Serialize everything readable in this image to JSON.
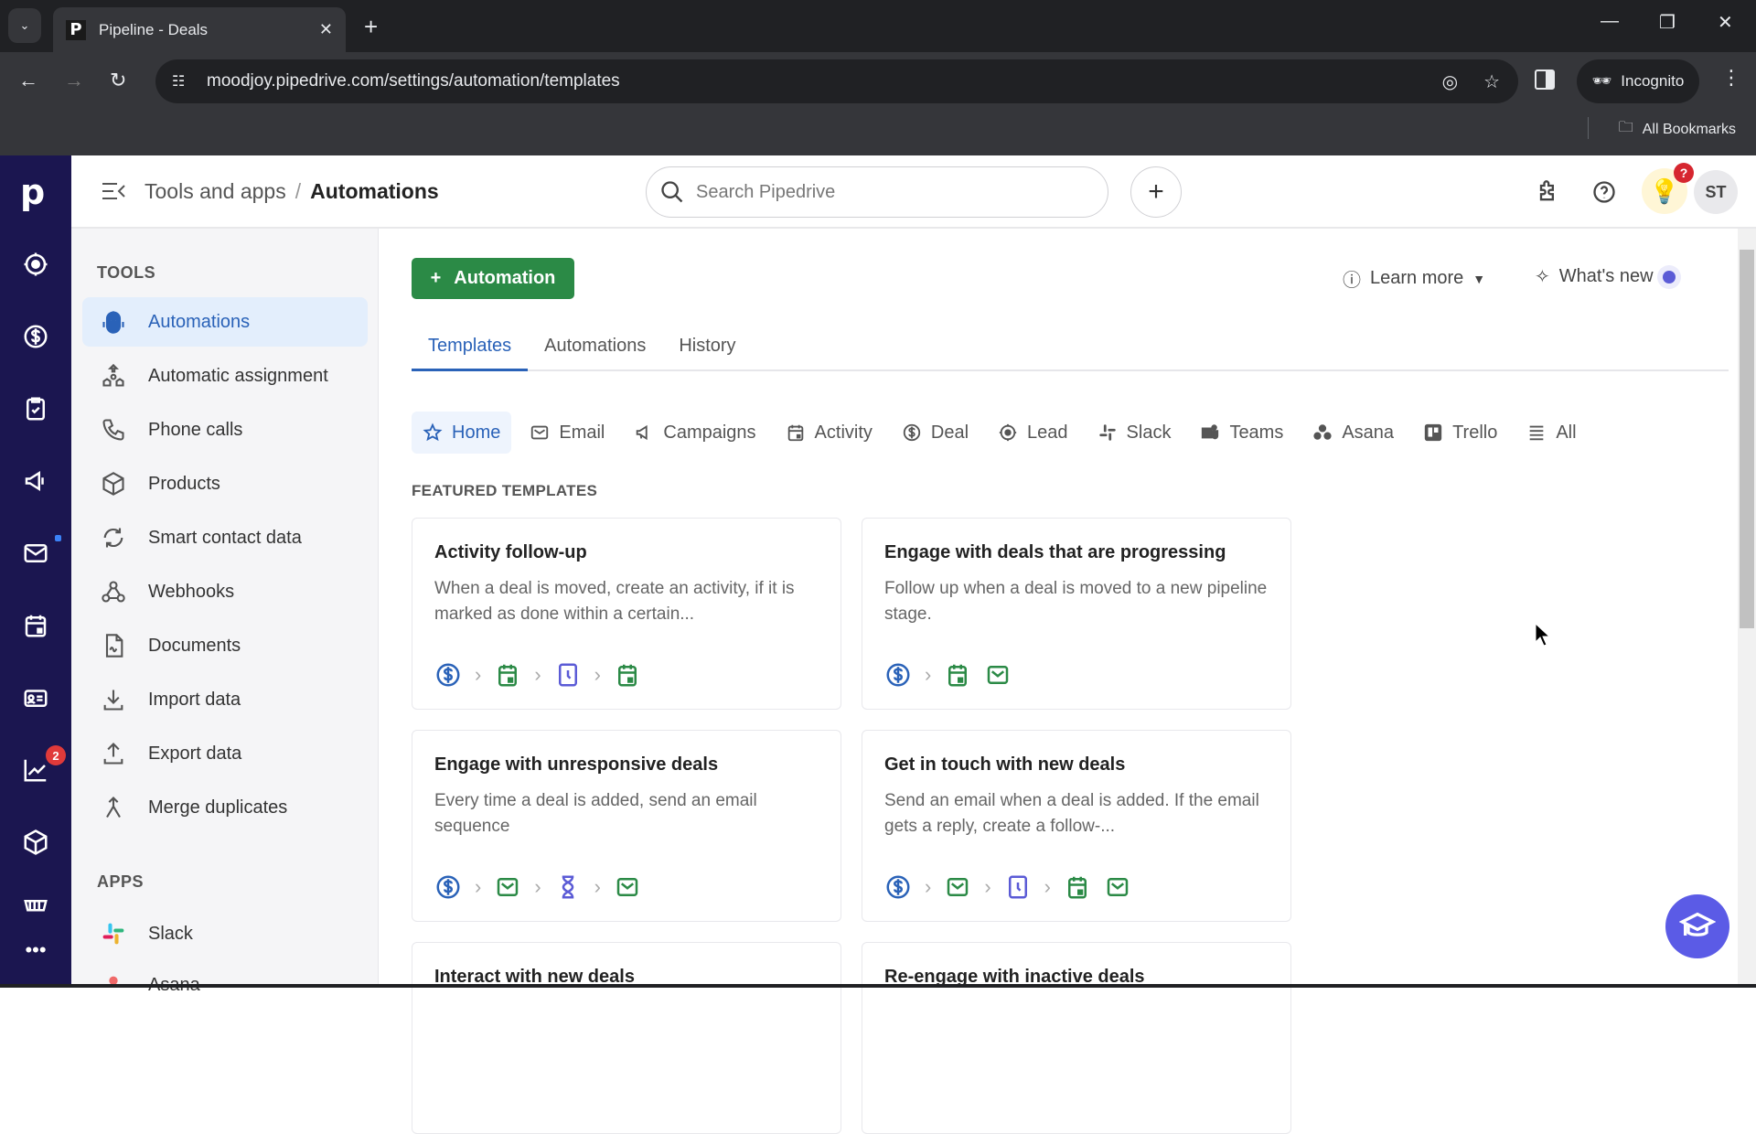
{
  "browser": {
    "tab_title": "Pipeline - Deals",
    "tab_favicon": "P",
    "url": "moodjoy.pipedrive.com/settings/automation/templates",
    "incognito_label": "Incognito",
    "bookmarks_label": "All Bookmarks"
  },
  "app": {
    "logo": "p",
    "breadcrumb": {
      "parent": "Tools and apps",
      "separator": "/",
      "current": "Automations"
    },
    "search_placeholder": "Search Pipedrive",
    "add_label": "+",
    "help_badge": "?",
    "avatar_initials": "ST",
    "rail_badge_count": "2"
  },
  "sidebar": {
    "tools_title": "TOOLS",
    "tools": [
      {
        "label": "Automations",
        "icon": "robot-icon",
        "active": true
      },
      {
        "label": "Automatic assignment",
        "icon": "assignment-icon"
      },
      {
        "label": "Phone calls",
        "icon": "phone-icon"
      },
      {
        "label": "Products",
        "icon": "box-icon"
      },
      {
        "label": "Smart contact data",
        "icon": "sync-icon"
      },
      {
        "label": "Webhooks",
        "icon": "webhook-icon"
      },
      {
        "label": "Documents",
        "icon": "document-icon"
      },
      {
        "label": "Import data",
        "icon": "import-icon"
      },
      {
        "label": "Export data",
        "icon": "export-icon"
      },
      {
        "label": "Merge duplicates",
        "icon": "merge-icon"
      }
    ],
    "apps_title": "APPS",
    "apps": [
      {
        "label": "Slack",
        "icon": "slack-icon"
      },
      {
        "label": "Asana",
        "icon": "asana-icon"
      }
    ]
  },
  "main": {
    "add_automation_label": "Automation",
    "learn_more_label": "Learn more",
    "whats_new_label": "What's new",
    "tabs": [
      {
        "label": "Templates",
        "active": true
      },
      {
        "label": "Automations"
      },
      {
        "label": "History"
      }
    ],
    "categories": [
      {
        "label": "Home",
        "icon": "star-icon",
        "active": true
      },
      {
        "label": "Email",
        "icon": "mail-icon"
      },
      {
        "label": "Campaigns",
        "icon": "megaphone-icon"
      },
      {
        "label": "Activity",
        "icon": "calendar-icon"
      },
      {
        "label": "Deal",
        "icon": "dollar-icon"
      },
      {
        "label": "Lead",
        "icon": "target-icon"
      },
      {
        "label": "Slack",
        "icon": "slack-icon"
      },
      {
        "label": "Teams",
        "icon": "teams-icon"
      },
      {
        "label": "Asana",
        "icon": "asana-icon"
      },
      {
        "label": "Trello",
        "icon": "trello-icon"
      },
      {
        "label": "All",
        "icon": "list-icon"
      }
    ],
    "featured_title": "FEATURED TEMPLATES",
    "templates": [
      {
        "title": "Activity follow-up",
        "description": "When a deal is moved, create an activity, if it is marked as done within a certain...",
        "steps": [
          "deal",
          ">",
          "activity",
          ">",
          "clock",
          ">",
          "activity"
        ]
      },
      {
        "title": "Engage with deals that are progressing",
        "description": "Follow up when a deal is moved to a new pipeline stage.",
        "steps": [
          "deal",
          ">",
          "activity",
          "email"
        ]
      },
      {
        "title": "Engage with unresponsive deals",
        "description": "Every time a deal is added, send an email sequence",
        "steps": [
          "deal",
          ">",
          "email",
          ">",
          "hourglass",
          ">",
          "email"
        ]
      },
      {
        "title": "Get in touch with new deals",
        "description": "Send an email when a deal is added. If the email gets a reply, create a follow-...",
        "steps": [
          "deal",
          ">",
          "email",
          ">",
          "clock",
          ">",
          "activity",
          "email"
        ]
      },
      {
        "title": "Interact with new deals",
        "description": "",
        "steps": []
      },
      {
        "title": "Re-engage with inactive deals",
        "description": "",
        "steps": []
      }
    ]
  },
  "colors": {
    "rail": "#1b1650",
    "primary_green": "#2b8a46",
    "accent_blue": "#2a62b8",
    "purple": "#5b5be6",
    "step_green": "#2b8a46",
    "step_blue": "#2a62b8",
    "step_purple": "#6a5acd"
  }
}
